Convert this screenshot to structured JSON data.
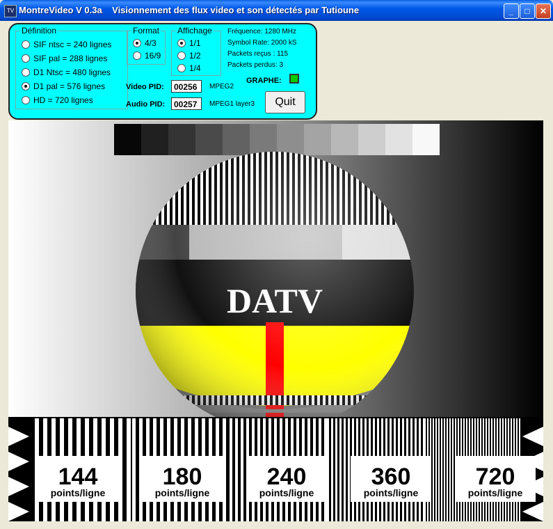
{
  "window": {
    "title": "MontreVideo V 0.3a    Visionnement des flux video et son détectés par Tutioune",
    "icon_text": "TV",
    "buttons": {
      "minimize": "_",
      "maximize": "□",
      "close": "✕"
    }
  },
  "definition": {
    "legend": "Définition",
    "options": [
      {
        "label": "SIF ntsc = 240 lignes",
        "selected": false
      },
      {
        "label": "SIF pal = 288 lignes",
        "selected": false
      },
      {
        "label": "D1 Ntsc = 480 lignes",
        "selected": false
      },
      {
        "label": "D1 pal = 576 lignes",
        "selected": true
      },
      {
        "label": "HD = 720 lignes",
        "selected": false
      }
    ]
  },
  "format": {
    "legend": "Format",
    "options": [
      {
        "label": "4/3",
        "selected": true
      },
      {
        "label": "16/9",
        "selected": false
      }
    ]
  },
  "affichage": {
    "legend": "Affichage",
    "options": [
      {
        "label": "1/1",
        "selected": true
      },
      {
        "label": "1/2",
        "selected": false
      },
      {
        "label": "1/4",
        "selected": false
      }
    ]
  },
  "stats": {
    "frequence": "Fréquence: 1280 MHz",
    "symbol_rate": "Symbol Rate: 2000 kS",
    "packets_recus": "Packets reçus :  115",
    "packets_perdus": "Packets perdus: 3"
  },
  "graphe": {
    "label": "GRAPHE:",
    "color": "#00cc00"
  },
  "video_pid": {
    "label": "Video PID:",
    "value": "00256",
    "codec": "MPEG2"
  },
  "audio_pid": {
    "label": "Audio PID:",
    "value": "00257",
    "codec": "MPEG1 layer3"
  },
  "quit_label": "Quit",
  "test_card": {
    "logo": "DATV",
    "blocks": [
      {
        "number": "144",
        "unit": "points/ligne"
      },
      {
        "number": "180",
        "unit": "points/ligne"
      },
      {
        "number": "240",
        "unit": "points/ligne"
      },
      {
        "number": "360",
        "unit": "points/ligne"
      },
      {
        "number": "720",
        "unit": "points/ligne"
      }
    ],
    "gray_levels": [
      "#070707",
      "#202020",
      "#343434",
      "#4a4a4a",
      "#626262",
      "#7a7a7a",
      "#8e8e8e",
      "#a4a4a4",
      "#b8b8b8",
      "#cecece",
      "#e2e2e2",
      "#f8f8f8"
    ]
  }
}
